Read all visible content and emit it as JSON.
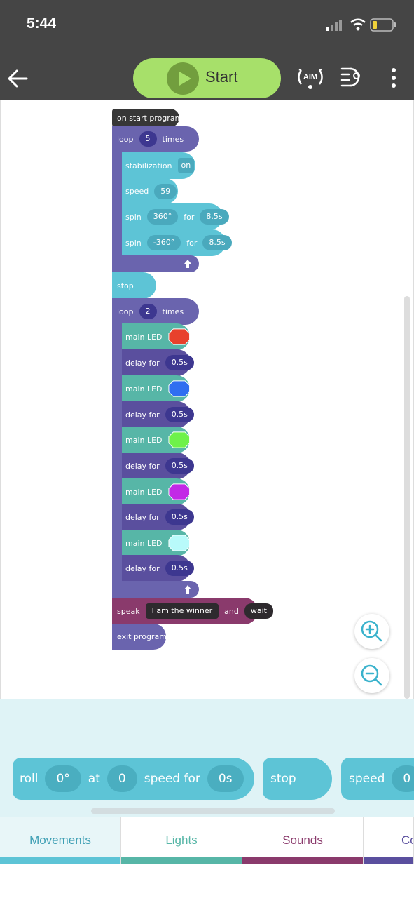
{
  "status_bar": {
    "time": "5:44"
  },
  "toolbar": {
    "start_label": "Start",
    "aim_label": "AIM"
  },
  "program": {
    "on_start": "on start program",
    "loop1": {
      "label": "loop",
      "count": "5",
      "suffix": "times"
    },
    "stabilization": {
      "label": "stabilization",
      "value": "on"
    },
    "speed": {
      "label": "speed",
      "value": "59"
    },
    "spin1": {
      "label": "spin",
      "angle": "360°",
      "for": "for",
      "duration": "8.5s"
    },
    "spin2": {
      "label": "spin",
      "angle": "-360°",
      "for": "for",
      "duration": "8.5s"
    },
    "stop": "stop",
    "loop2": {
      "label": "loop",
      "count": "2",
      "suffix": "times"
    },
    "led_label": "main LED",
    "delay_label": "delay for",
    "delay_value": "0.5s",
    "led_colors": [
      "#e8412c",
      "#2f6ef0",
      "#6ef24a",
      "#c22ae6",
      "#b8fafa"
    ],
    "speak": {
      "label": "speak",
      "text": "I am the winner",
      "and": "and",
      "wait": "wait"
    },
    "exit": "exit program"
  },
  "palette": {
    "roll": {
      "label": "roll",
      "angle": "0°",
      "at": "at",
      "speed": "0",
      "speed_for": "speed for",
      "duration": "0s"
    },
    "stop": "stop",
    "speed": {
      "label": "speed",
      "value": "0"
    }
  },
  "tabs": [
    {
      "label": "Movements",
      "color": "#5dc4d6",
      "text_color": "#3e9fb4"
    },
    {
      "label": "Lights",
      "color": "#57b6a7",
      "text_color": "#57b6a7"
    },
    {
      "label": "Sounds",
      "color": "#8a3a6c",
      "text_color": "#8a3a6c"
    },
    {
      "label": "Co",
      "color": "#5a4f9e",
      "text_color": "#5a4f9e"
    }
  ]
}
